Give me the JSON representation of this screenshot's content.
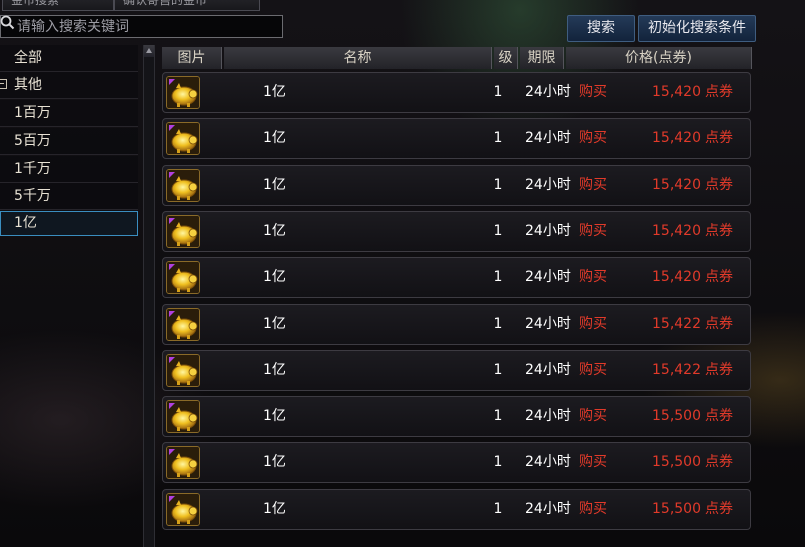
{
  "top_tabs": [
    "金币搜索",
    "确认寄售的金币"
  ],
  "search": {
    "placeholder": "请输入搜索关键词"
  },
  "buttons": {
    "search": "搜索",
    "reset": "初始化搜索条件"
  },
  "sidebar": {
    "items": [
      {
        "label": "全部"
      },
      {
        "label": "其他"
      },
      {
        "label": "1百万"
      },
      {
        "label": "5百万"
      },
      {
        "label": "1千万"
      },
      {
        "label": "5千万"
      },
      {
        "label": "1亿"
      }
    ],
    "selected": "1亿"
  },
  "table": {
    "headers": {
      "image": "图片",
      "name": "名称",
      "level": "级",
      "period": "期限",
      "price": "价格(点券)"
    },
    "rows": [
      {
        "name": "1亿",
        "level": "1",
        "period": "24小时",
        "action": "购买",
        "price": "15,420",
        "unit": "点券"
      },
      {
        "name": "1亿",
        "level": "1",
        "period": "24小时",
        "action": "购买",
        "price": "15,420",
        "unit": "点券"
      },
      {
        "name": "1亿",
        "level": "1",
        "period": "24小时",
        "action": "购买",
        "price": "15,420",
        "unit": "点券"
      },
      {
        "name": "1亿",
        "level": "1",
        "period": "24小时",
        "action": "购买",
        "price": "15,420",
        "unit": "点券"
      },
      {
        "name": "1亿",
        "level": "1",
        "period": "24小时",
        "action": "购买",
        "price": "15,420",
        "unit": "点券"
      },
      {
        "name": "1亿",
        "level": "1",
        "period": "24小时",
        "action": "购买",
        "price": "15,422",
        "unit": "点券"
      },
      {
        "name": "1亿",
        "level": "1",
        "period": "24小时",
        "action": "购买",
        "price": "15,422",
        "unit": "点券"
      },
      {
        "name": "1亿",
        "level": "1",
        "period": "24小时",
        "action": "购买",
        "price": "15,500",
        "unit": "点券"
      },
      {
        "name": "1亿",
        "level": "1",
        "period": "24小时",
        "action": "购买",
        "price": "15,500",
        "unit": "点券"
      },
      {
        "name": "1亿",
        "level": "1",
        "period": "24小时",
        "action": "购买",
        "price": "15,500",
        "unit": "点券"
      }
    ]
  },
  "icons": {
    "item": "gold-pig-icon",
    "search": "magnifier-icon"
  },
  "colors": {
    "price": "#e13a2a",
    "selection_border": "#3a8ec0",
    "button": "#1b2f4c"
  }
}
